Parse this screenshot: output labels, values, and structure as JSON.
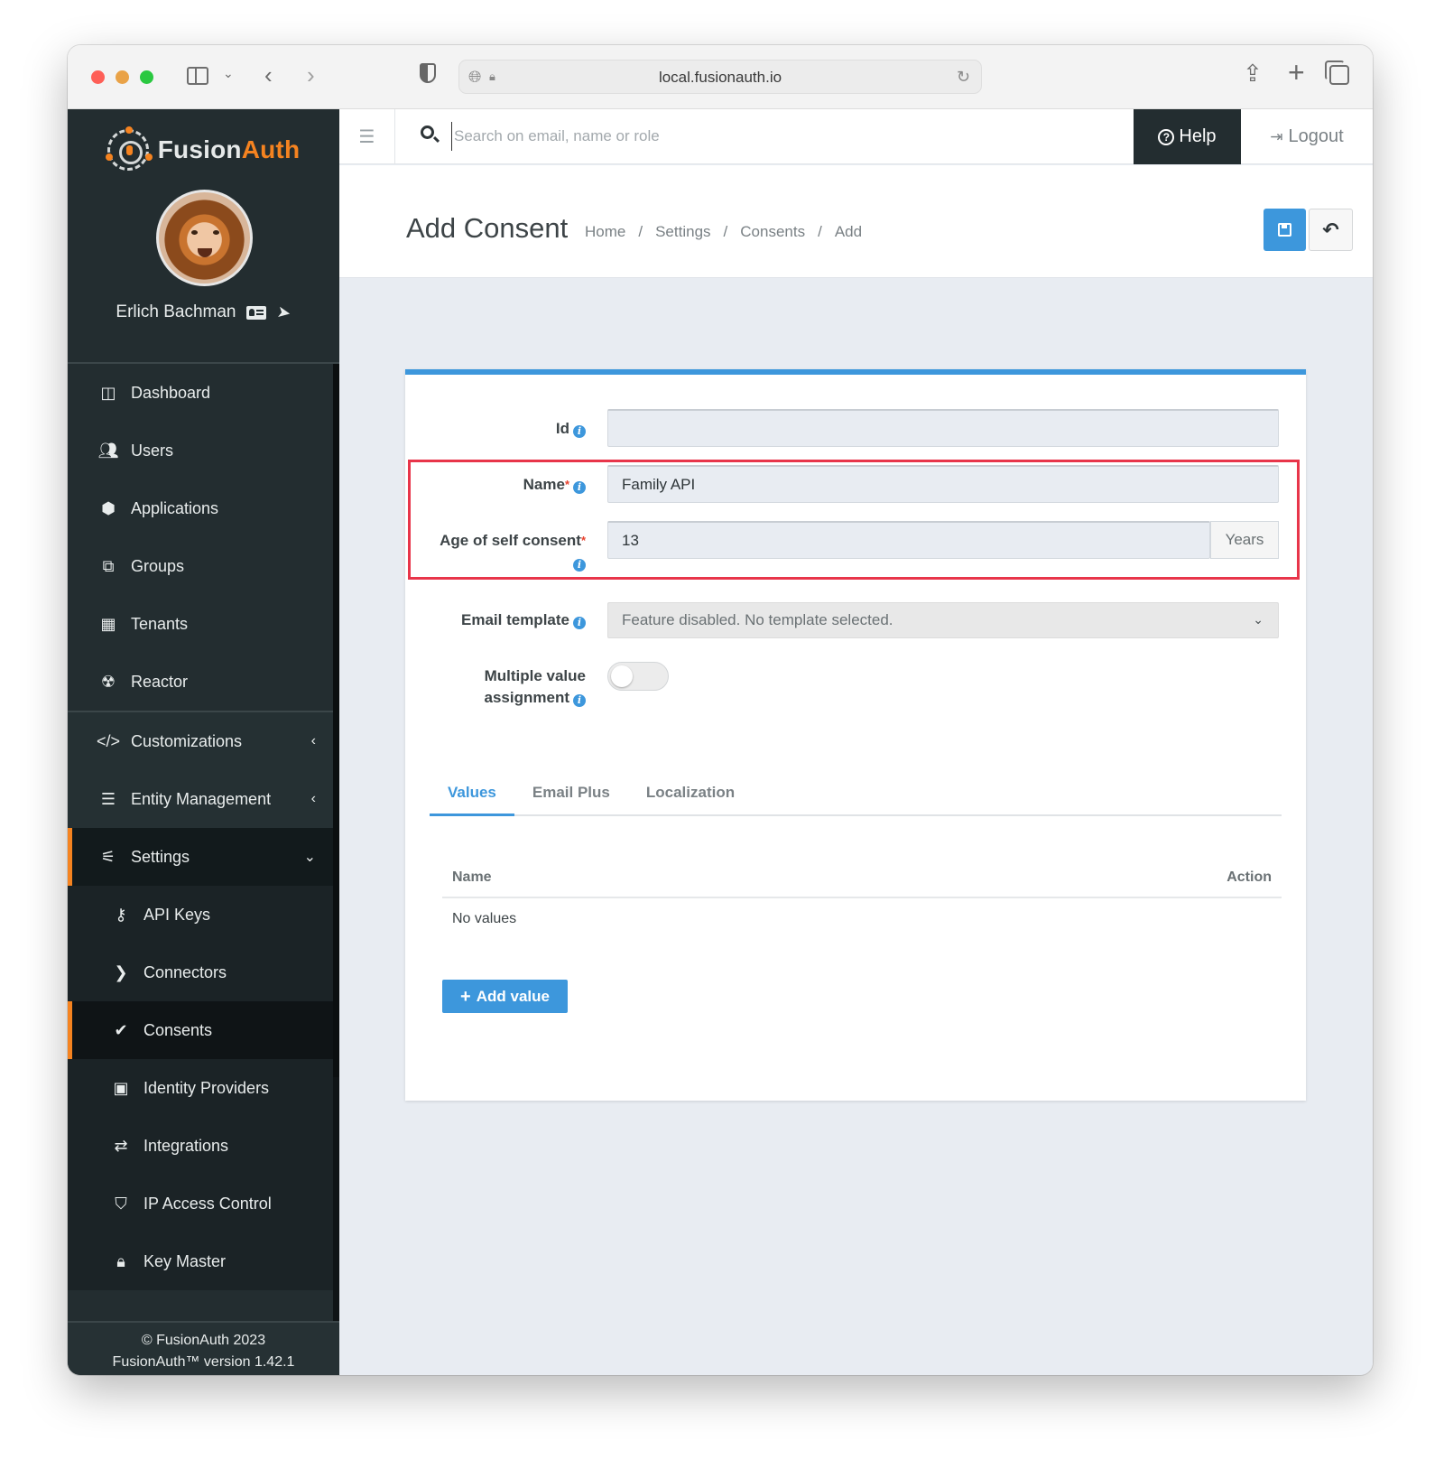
{
  "browser": {
    "url": "local.fusionauth.io"
  },
  "brand": {
    "name_part1": "Fusion",
    "name_part2": "Auth",
    "accent_color": "#f58320"
  },
  "user": {
    "name": "Erlich Bachman"
  },
  "sidebar": {
    "items": [
      {
        "label": "Dashboard",
        "icon": "columns-icon"
      },
      {
        "label": "Users",
        "icon": "users-icon"
      },
      {
        "label": "Applications",
        "icon": "cube-icon"
      },
      {
        "label": "Groups",
        "icon": "object-group-icon"
      },
      {
        "label": "Tenants",
        "icon": "building-icon"
      },
      {
        "label": "Reactor",
        "icon": "radiation-icon"
      }
    ],
    "groups": [
      {
        "label": "Customizations",
        "icon": "code-icon",
        "state": "collapsed"
      },
      {
        "label": "Entity Management",
        "icon": "server-icon",
        "state": "collapsed"
      },
      {
        "label": "Settings",
        "icon": "sliders-icon",
        "state": "expanded"
      }
    ],
    "settings_items": [
      {
        "label": "API Keys",
        "icon": "key-icon"
      },
      {
        "label": "Connectors",
        "icon": "chevron-right-icon"
      },
      {
        "label": "Consents",
        "icon": "check-icon",
        "active": true
      },
      {
        "label": "Identity Providers",
        "icon": "id-badge-icon"
      },
      {
        "label": "Integrations",
        "icon": "exchange-icon"
      },
      {
        "label": "IP Access Control",
        "icon": "shield-icon"
      },
      {
        "label": "Key Master",
        "icon": "lock-icon"
      }
    ],
    "footer": {
      "copyright": "© FusionAuth 2023",
      "version": "FusionAuth™ version 1.42.1"
    }
  },
  "appbar": {
    "search_placeholder": "Search on email, name or role",
    "help_label": "Help",
    "logout_label": "Logout"
  },
  "page": {
    "title": "Add Consent",
    "breadcrumb": [
      "Home",
      "Settings",
      "Consents",
      "Add"
    ],
    "primary_color": "#3d97dc"
  },
  "form": {
    "id": {
      "label": "Id",
      "value": ""
    },
    "name": {
      "label": "Name",
      "required": "*",
      "value": "Family API"
    },
    "age": {
      "label": "Age of self consent",
      "required": "*",
      "value": "13",
      "addon": "Years"
    },
    "email_template": {
      "label": "Email template",
      "value": "Feature disabled. No template selected."
    },
    "multiple_value": {
      "label_line1": "Multiple value",
      "label_line2": "assignment",
      "enabled": false
    },
    "highlight_color": "#e8354a"
  },
  "tabs": [
    {
      "label": "Values",
      "active": true
    },
    {
      "label": "Email Plus",
      "active": false
    },
    {
      "label": "Localization",
      "active": false
    }
  ],
  "values_table": {
    "columns": [
      "Name",
      "Action"
    ],
    "empty_text": "No values",
    "add_button": "Add value"
  }
}
